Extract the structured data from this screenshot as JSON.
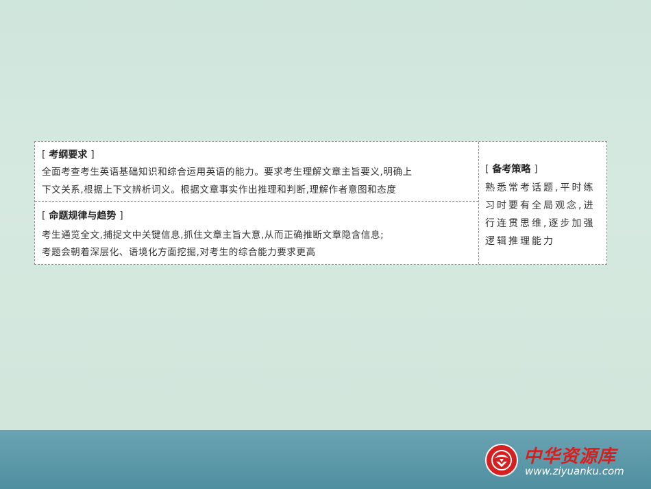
{
  "section1": {
    "heading": "考纲要求",
    "lines": [
      "全面考查考生英语基础知识和综合运用英语的能力。要求考生理解文章主旨要义,明确上",
      "下文关系,根据上下文辨析词义。根据文章事实作出推理和判断,理解作者意图和态度"
    ]
  },
  "section2": {
    "heading": "命题规律与趋势",
    "lines": [
      "考生通览全文,捕捉文中关键信息,抓住文章主旨大意,从而正确推断文章隐含信息;",
      "考题会朝着深层化、语境化方面挖掘,对考生的综合能力要求更高"
    ]
  },
  "section3": {
    "heading": "备考策略",
    "lines": [
      "熟悉常考话题,平时练",
      "习时要有全局观念,进",
      "行连贯思维,逐步加强",
      "逻辑推理能力"
    ]
  },
  "brackets": {
    "open": "[",
    "close": "]"
  },
  "logo": {
    "name": "中华资源库",
    "url": "www.ziyuanku.com",
    "icon": "ziyuanku-logo-icon",
    "brand_color": "#d61f1f"
  },
  "colors": {
    "background": "#d3e7dd",
    "band": "#5c99a9"
  }
}
